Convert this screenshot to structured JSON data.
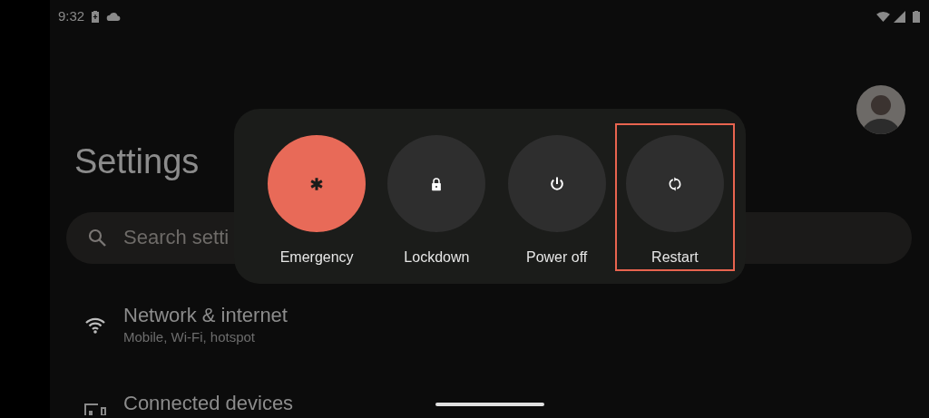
{
  "status_bar": {
    "time": "9:32"
  },
  "settings": {
    "title": "Settings",
    "search": {
      "placeholder": "Search setti"
    },
    "items": [
      {
        "kind": "network",
        "title": "Network & internet",
        "subtitle": "Mobile, Wi-Fi, hotspot"
      },
      {
        "kind": "devices",
        "title": "Connected devices"
      }
    ]
  },
  "power_menu": {
    "actions": [
      {
        "kind": "emergency",
        "label": "Emergency",
        "highlighted": false
      },
      {
        "kind": "lockdown",
        "label": "Lockdown",
        "highlighted": false
      },
      {
        "kind": "power",
        "label": "Power off",
        "highlighted": false
      },
      {
        "kind": "restart",
        "label": "Restart",
        "highlighted": true
      }
    ]
  }
}
